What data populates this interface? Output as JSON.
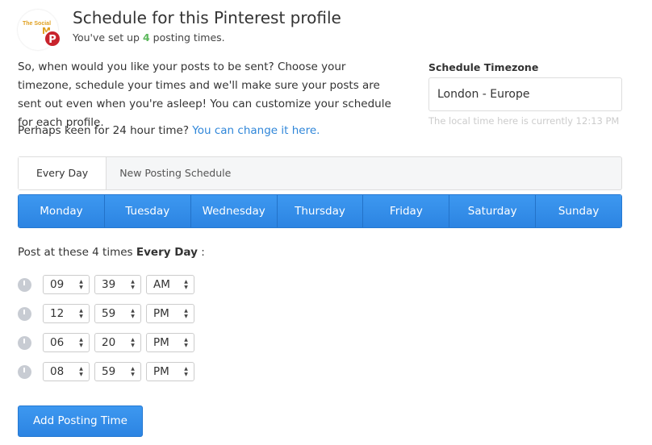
{
  "profile": {
    "logo_text": "The Social Media",
    "network": "Pinterest",
    "network_color": "#c8232c"
  },
  "header": {
    "title": "Schedule for this Pinterest profile",
    "sub_prefix": "You've set up ",
    "count": "4",
    "sub_suffix": " posting times."
  },
  "intro": "So, when would you like your posts to be sent? Choose your timezone, schedule your times and we'll make sure your posts are sent out even when you're asleep! You can customize your schedule for each profile.",
  "hour": {
    "text": "Perhaps keen for 24 hour time? ",
    "link": "You can change it here."
  },
  "timezone": {
    "label": "Schedule Timezone",
    "value": "London - Europe",
    "local": "The local time here is currently 12:13 PM"
  },
  "tabs": [
    {
      "label": "Every Day",
      "active": true
    },
    {
      "label": "New Posting Schedule",
      "active": false
    }
  ],
  "days": [
    "Monday",
    "Tuesday",
    "Wednesday",
    "Thursday",
    "Friday",
    "Saturday",
    "Sunday"
  ],
  "post": {
    "prefix": "Post at these 4 times ",
    "bold": "Every Day",
    "suffix": " :"
  },
  "times": [
    {
      "h": "09",
      "m": "39",
      "ampm": "AM"
    },
    {
      "h": "12",
      "m": "59",
      "ampm": "PM"
    },
    {
      "h": "06",
      "m": "20",
      "ampm": "PM"
    },
    {
      "h": "08",
      "m": "59",
      "ampm": "PM"
    }
  ],
  "add_button": "Add Posting Time",
  "colors": {
    "accent": "#2f86d9",
    "count": "#5cb85c"
  }
}
